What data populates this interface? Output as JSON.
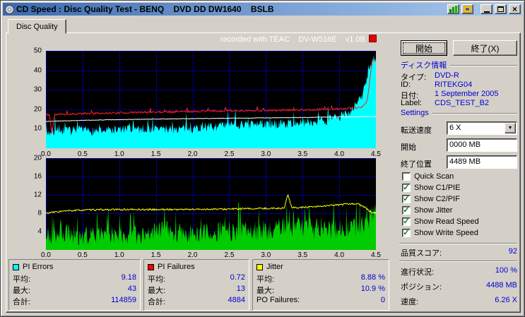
{
  "window": {
    "title": "CD Speed : Disc Quality Test - BENQ    DVD DD DW1640    BSLB"
  },
  "tabs": {
    "disc_quality": "Disc Quality"
  },
  "recorder_line": "recorded with TEAC    DV-W516E    v1.0B",
  "actions": {
    "start": "開始",
    "exit": "終了(X)"
  },
  "disc_info": {
    "title": "ディスク情報",
    "rows": [
      {
        "label": "タイプ:",
        "value": "DVD-R"
      },
      {
        "label": "ID:",
        "value": "RITEKG04"
      },
      {
        "label": "日付:",
        "value": "1 September 2005"
      },
      {
        "label": "Label:",
        "value": "CDS_TEST_B2"
      }
    ]
  },
  "settings": {
    "title": "Settings",
    "speed": {
      "label": "転送速度",
      "value": "6 X"
    },
    "start": {
      "label": "開始",
      "value": "0000 MB"
    },
    "end": {
      "label": "終了位置",
      "value": "4489 MB"
    },
    "checkboxes": [
      {
        "label": "Quick Scan",
        "checked": false
      },
      {
        "label": "Show C1/PIE",
        "checked": true
      },
      {
        "label": "Show C2/PIF",
        "checked": true
      },
      {
        "label": "Show Jitter",
        "checked": true
      },
      {
        "label": "Show Read Speed",
        "checked": true
      },
      {
        "label": "Show Write Speed",
        "checked": true
      }
    ]
  },
  "score": {
    "label": "品質スコア:",
    "value": "92"
  },
  "status": {
    "rows": [
      {
        "label": "進行状況:",
        "value": "100 %"
      },
      {
        "label": "ポジション:",
        "value": "4488 MB"
      },
      {
        "label": "速度:",
        "value": "6.26 X"
      }
    ]
  },
  "legend_panels": [
    {
      "title": "PI Errors",
      "color": "#00ffff",
      "rows": [
        {
          "label": "平均:",
          "value": "9.18"
        },
        {
          "label": "最大:",
          "value": "43"
        },
        {
          "label": "合計:",
          "value": "114859"
        }
      ]
    },
    {
      "title": "PI Failures",
      "color": "#ff0000",
      "rows": [
        {
          "label": "平均:",
          "value": "0.72"
        },
        {
          "label": "最大:",
          "value": "13"
        },
        {
          "label": "合計:",
          "value": "4884"
        }
      ]
    },
    {
      "title": "Jitter",
      "color": "#ffff00",
      "rows": [
        {
          "label": "平均:",
          "value": "8.88 %"
        },
        {
          "label": "最大:",
          "value": "10.9 %"
        },
        {
          "label": "PO Failures:",
          "value": "0"
        }
      ]
    }
  ],
  "charts": {
    "x_ticks": [
      "0.0",
      "0.5",
      "1.0",
      "1.5",
      "2.0",
      "2.5",
      "3.0",
      "3.5",
      "4.0",
      "4.5"
    ],
    "x_max": 4.5,
    "grid_color": "#000090",
    "top": {
      "y_max": 50,
      "y_ticks": [
        "50",
        "40",
        "30",
        "20",
        "10"
      ],
      "series": [
        {
          "name": "pi-errors",
          "type": "area",
          "color": "#00ffff",
          "seed": 7,
          "noise": 2.5,
          "spike_chance": 0.1,
          "spike_amp": 8,
          "keypoints": [
            [
              0,
              8
            ],
            [
              0.3,
              9
            ],
            [
              0.7,
              9
            ],
            [
              1.2,
              10
            ],
            [
              1.8,
              10
            ],
            [
              2.3,
              11
            ],
            [
              2.6,
              12
            ],
            [
              3,
              12
            ],
            [
              3.4,
              13
            ],
            [
              3.8,
              14
            ],
            [
              4,
              16
            ],
            [
              4.15,
              19
            ],
            [
              4.3,
              26
            ],
            [
              4.4,
              38
            ],
            [
              4.45,
              46
            ]
          ]
        },
        {
          "name": "write-speed",
          "type": "line",
          "color": "#ffffff",
          "seed": 3,
          "noise": 0.12,
          "spike_chance": 0,
          "spike_amp": 0,
          "keypoints": [
            [
              0,
              13.8
            ],
            [
              0.5,
              14.3
            ],
            [
              1,
              14.7
            ],
            [
              1.5,
              15
            ],
            [
              2,
              15.2
            ],
            [
              2.5,
              15.4
            ],
            [
              3,
              15.6
            ],
            [
              3.5,
              15.8
            ],
            [
              4,
              16.1
            ],
            [
              4.45,
              16.3
            ]
          ]
        },
        {
          "name": "read-speed",
          "type": "line",
          "color": "#ff2020",
          "seed": 11,
          "noise": 0.5,
          "spike_chance": 0.05,
          "spike_amp": 2.5,
          "keypoints": [
            [
              0,
              17.2
            ],
            [
              0.05,
              17.2
            ],
            [
              0.08,
              7
            ],
            [
              0.12,
              17.3
            ],
            [
              0.5,
              17.8
            ],
            [
              1,
              18.2
            ],
            [
              1.5,
              18.6
            ],
            [
              2,
              18.9
            ],
            [
              2.5,
              19.2
            ],
            [
              3,
              19.4
            ],
            [
              3.5,
              19.7
            ],
            [
              4,
              20.2
            ],
            [
              4.3,
              20.8
            ],
            [
              4.38,
              24
            ],
            [
              4.45,
              45
            ]
          ]
        }
      ]
    },
    "bottom": {
      "y_max": 20,
      "y_ticks": [
        "20",
        "16",
        "12",
        "8",
        "4"
      ],
      "series": [
        {
          "name": "pi-failures",
          "type": "area",
          "color": "#00cc00",
          "seed": 21,
          "noise": 2.4,
          "spike_chance": 0.15,
          "spike_amp": 6,
          "keypoints": [
            [
              0,
              3.2
            ],
            [
              0.4,
              3.4
            ],
            [
              0.8,
              3.2
            ],
            [
              1.2,
              3.4
            ],
            [
              1.6,
              4.2
            ],
            [
              2,
              3.6
            ],
            [
              2.4,
              3.8
            ],
            [
              2.8,
              4.2
            ],
            [
              3.1,
              4.6
            ],
            [
              3.3,
              5.2
            ],
            [
              3.5,
              4.6
            ],
            [
              3.9,
              4.4
            ],
            [
              4.2,
              4.8
            ],
            [
              4.35,
              5.5
            ],
            [
              4.45,
              8
            ]
          ]
        },
        {
          "name": "jitter",
          "type": "line",
          "color": "#ffff00",
          "seed": 33,
          "noise": 0.18,
          "spike_chance": 0,
          "spike_amp": 0,
          "keypoints": [
            [
              0,
              8
            ],
            [
              0.2,
              8.4
            ],
            [
              0.5,
              8.7
            ],
            [
              1,
              8.8
            ],
            [
              1.5,
              8.8
            ],
            [
              2,
              8.85
            ],
            [
              2.5,
              8.9
            ],
            [
              3,
              9.05
            ],
            [
              3.25,
              9.1
            ],
            [
              3.3,
              12.2
            ],
            [
              3.35,
              9.2
            ],
            [
              3.6,
              9.3
            ],
            [
              3.9,
              9.7
            ],
            [
              4.1,
              10
            ],
            [
              4.25,
              10.1
            ],
            [
              4.35,
              9.2
            ],
            [
              4.45,
              8.1
            ]
          ]
        }
      ]
    }
  }
}
